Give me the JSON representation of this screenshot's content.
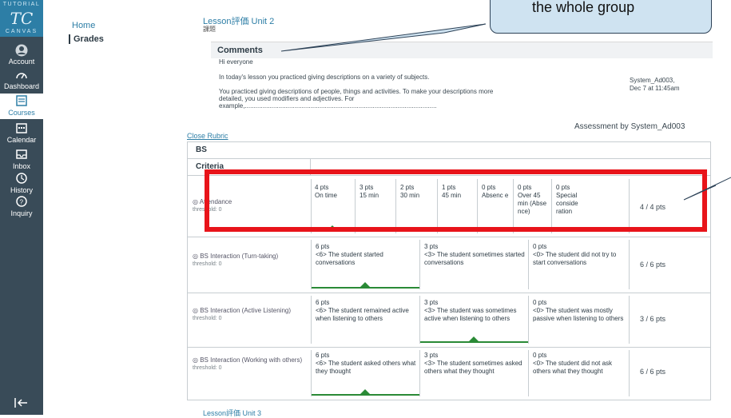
{
  "sidenav": {
    "logo": {
      "line1": "TUTORIAL",
      "mark": "TC",
      "line2": "CANVAS"
    },
    "items": [
      {
        "label": "Account",
        "icon": "account-icon"
      },
      {
        "label": "Dashboard",
        "icon": "dashboard-icon"
      },
      {
        "label": "Courses",
        "icon": "courses-icon",
        "active": true
      },
      {
        "label": "Calendar",
        "icon": "calendar-icon"
      },
      {
        "label": "Inbox",
        "icon": "inbox-icon"
      },
      {
        "label": "History",
        "icon": "history-icon"
      },
      {
        "label": "Inquiry",
        "icon": "inquiry-icon"
      }
    ],
    "collapse_icon": "collapse-icon"
  },
  "breadcrumb": {
    "home": "Home",
    "grades": "Grades"
  },
  "page": {
    "title": "Lesson評価 Unit 2",
    "subtitle": "課題"
  },
  "comments": {
    "header": "Comments",
    "lines": [
      "Hi everyone",
      "In today's lesson you practiced giving descriptions on a variety of subjects.",
      "You practiced giving descriptions of people, things and activities. To make your descriptions more",
      "detailed, you used modifiers and adjectives. For",
      "example,............................................................................................................"
    ],
    "author": "System_Ad003,",
    "date": "Dec 7 at 11:45am"
  },
  "assessment_by": "Assessment by System_Ad003",
  "close_rubric": "Close Rubric",
  "rubric": {
    "title": "BS",
    "criteria_header": "Criteria",
    "rows": [
      {
        "name": "Attendance",
        "threshold": "threshold: 0",
        "ratings": [
          {
            "pts": "4 pts",
            "desc": "On time"
          },
          {
            "pts": "3 pts",
            "desc": "15 min"
          },
          {
            "pts": "2 pts",
            "desc": "30 min"
          },
          {
            "pts": "1 pts",
            "desc": "45 min"
          },
          {
            "pts": "0 pts",
            "desc": "Absenc e"
          },
          {
            "pts": "0 pts",
            "desc": "Over 45 min (Abse nce)"
          },
          {
            "pts": "0 pts",
            "desc": "Special conside ration"
          }
        ],
        "score": "4 / 4 pts"
      },
      {
        "name": "BS Interaction (Turn-taking)",
        "threshold": "threshold: 0",
        "ratings": [
          {
            "pts": "6 pts",
            "desc": "<6> The student started conversations"
          },
          {
            "pts": "3 pts",
            "desc": "<3> The student sometimes started conversations"
          },
          {
            "pts": "0 pts",
            "desc": "<0> The student did not try to start conversations"
          }
        ],
        "score": "6 / 6 pts"
      },
      {
        "name": "BS Interaction (Active Listening)",
        "threshold": "threshold: 0",
        "ratings": [
          {
            "pts": "6 pts",
            "desc": "<6> The student remained active when listening to others"
          },
          {
            "pts": "3 pts",
            "desc": "<3> The student was sometimes active when listening to others"
          },
          {
            "pts": "0 pts",
            "desc": "<0> The student was mostly passive when listening to others"
          }
        ],
        "score": "3 / 6 pts"
      },
      {
        "name": "BS Interaction (Working with others)",
        "threshold": "threshold: 0",
        "ratings": [
          {
            "pts": "6 pts",
            "desc": "<6> The student asked others what they thought"
          },
          {
            "pts": "3 pts",
            "desc": "<3> The student sometimes asked others what they thought"
          },
          {
            "pts": "0 pts",
            "desc": "<0> The student did not ask others what they thought"
          }
        ],
        "score": "6 / 6 pts"
      }
    ]
  },
  "callout": {
    "text": "the whole group"
  },
  "footer": {
    "link": "Lesson評価 Unit 3"
  },
  "colors": {
    "accent": "#2d7ea6",
    "sidenav": "#394b58",
    "highlight": "#e8141a",
    "selected": "#2a8a36"
  }
}
